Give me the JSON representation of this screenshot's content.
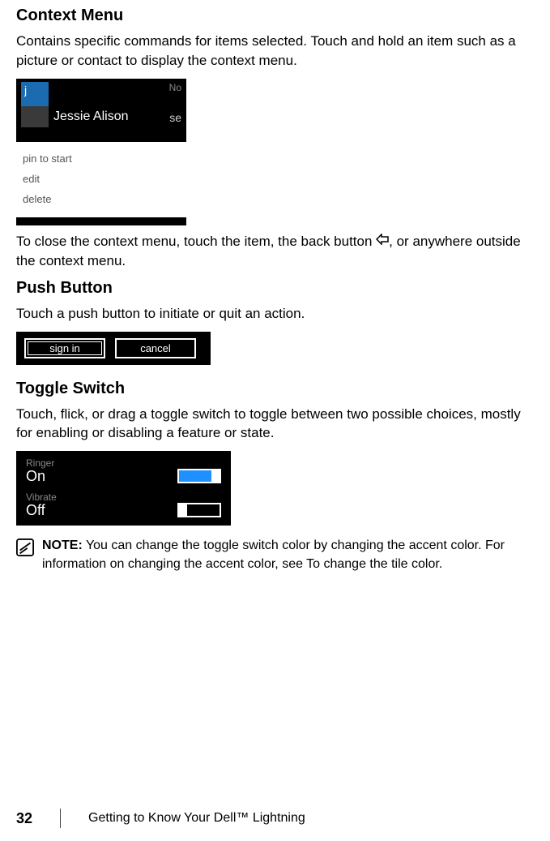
{
  "section1": {
    "heading": "Context Menu",
    "desc": "Contains specific commands for items selected. Touch and hold an item such as a picture or contact to display the context menu.",
    "close_before": "To close the context menu, touch the item, the back button ",
    "close_after": ", or anywhere outside the context menu."
  },
  "context_img": {
    "tile_letter": "j",
    "name": "Jessie Alison",
    "side1": "No",
    "side2": "se",
    "menu": [
      "pin to start",
      "edit",
      "delete"
    ]
  },
  "section2": {
    "heading": "Push Button",
    "desc": "Touch a push button to initiate or quit an action.",
    "btn1": "sign in",
    "btn2": "cancel"
  },
  "section3": {
    "heading": "Toggle Switch",
    "desc": "Touch, flick, or drag a toggle switch to toggle between two possible choices, mostly for enabling or disabling a feature or state.",
    "ringer_label": "Ringer",
    "ringer_state": "On",
    "vibrate_label": "Vibrate",
    "vibrate_state": "Off"
  },
  "note": {
    "bold": "NOTE:",
    "text": " You can change the toggle switch color by changing the accent color. For information on changing the accent color, see To change the tile color."
  },
  "footer": {
    "page": "32",
    "title": "Getting to Know Your Dell™ Lightning"
  }
}
